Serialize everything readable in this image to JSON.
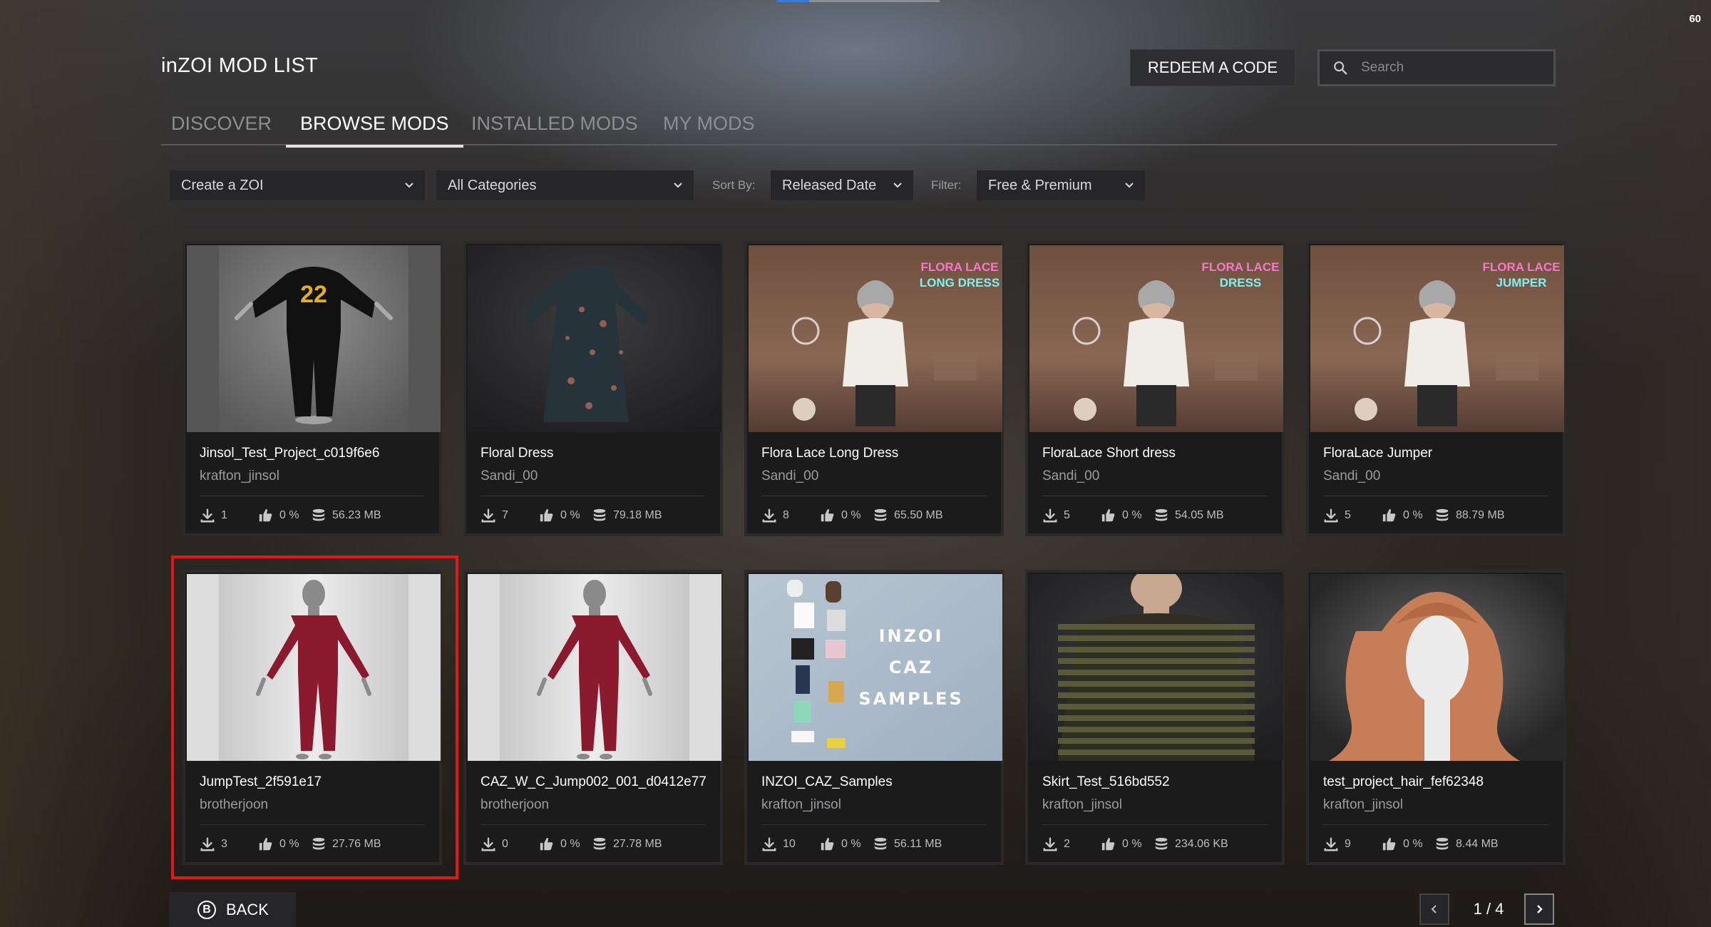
{
  "overlay": {
    "fps": "60"
  },
  "header": {
    "title": "inZOI MOD LIST",
    "redeem_label": "REDEEM A CODE",
    "search_placeholder": "Search"
  },
  "tabs": [
    {
      "label": "DISCOVER",
      "active": false
    },
    {
      "label": "BROWSE MODS",
      "active": true
    },
    {
      "label": "INSTALLED MODS",
      "active": false
    },
    {
      "label": "MY MODS",
      "active": false
    }
  ],
  "filters": {
    "category_group": "Create a ZOI",
    "category": "All Categories",
    "sort_label": "Sort By:",
    "sort_value": "Released Date",
    "filter_label": "Filter:",
    "filter_value": "Free & Premium"
  },
  "mods": [
    {
      "name": "Jinsol_Test_Project_c019f6e6",
      "author": "krafton_jinsol",
      "downloads": "1",
      "likes": "0 %",
      "size": "56.23 MB",
      "thumb": "jersey"
    },
    {
      "name": "Floral Dress",
      "author": "Sandi_00",
      "downloads": "7",
      "likes": "0 %",
      "size": "79.18 MB",
      "thumb": "dress"
    },
    {
      "name": "Flora Lace Long Dress",
      "author": "Sandi_00",
      "downloads": "8",
      "likes": "0 %",
      "size": "65.50 MB",
      "thumb": "room",
      "thumb_text": "FLORA LACE LONG DRESS"
    },
    {
      "name": "FloraLace Short dress",
      "author": "Sandi_00",
      "downloads": "5",
      "likes": "0 %",
      "size": "54.05 MB",
      "thumb": "room",
      "thumb_text": "FLORA LACE DRESS"
    },
    {
      "name": "FloraLace Jumper",
      "author": "Sandi_00",
      "downloads": "5",
      "likes": "0 %",
      "size": "88.79 MB",
      "thumb": "room",
      "thumb_text": "FLORA LACE JUMPER"
    },
    {
      "name": "JumpTest_2f591e17",
      "author": "brotherjoon",
      "downloads": "3",
      "likes": "0 %",
      "size": "27.76 MB",
      "thumb": "mannequin"
    },
    {
      "name": "CAZ_W_C_Jump002_001_d0412e77",
      "author": "brotherjoon",
      "downloads": "0",
      "likes": "0 %",
      "size": "27.78 MB",
      "thumb": "mannequin"
    },
    {
      "name": "INZOI_CAZ_Samples",
      "author": "krafton_jinsol",
      "downloads": "10",
      "likes": "0 %",
      "size": "56.11 MB",
      "thumb": "samples",
      "thumb_text": "INZOI CAZ SAMPLES"
    },
    {
      "name": "Skirt_Test_516bd552",
      "author": "krafton_jinsol",
      "downloads": "2",
      "likes": "0 %",
      "size": "234.06 KB",
      "thumb": "sweater"
    },
    {
      "name": "test_project_hair_fef62348",
      "author": "krafton_jinsol",
      "downloads": "9",
      "likes": "0 %",
      "size": "8.44 MB",
      "thumb": "hair"
    }
  ],
  "footer": {
    "back_label": "BACK",
    "back_key": "B",
    "page_text": "1 / 4"
  },
  "colors": {
    "highlight": "#e01818",
    "active_tab_underline": "#e0e0e0"
  }
}
